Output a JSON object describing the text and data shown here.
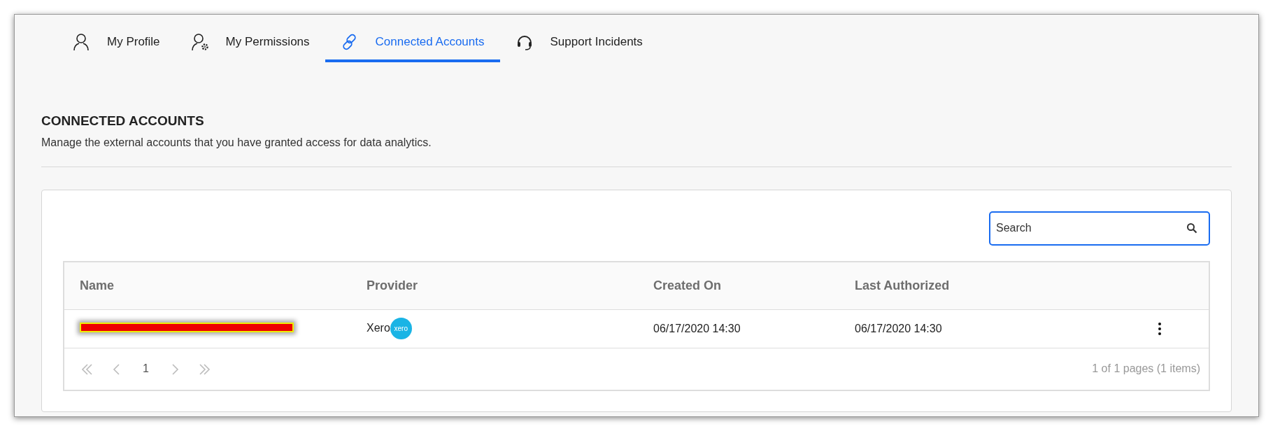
{
  "tabs": [
    {
      "label": "My Profile",
      "selected": false
    },
    {
      "label": "My Permissions",
      "selected": false
    },
    {
      "label": "Connected Accounts",
      "selected": true
    },
    {
      "label": "Support Incidents",
      "selected": false
    }
  ],
  "section": {
    "title": "CONNECTED ACCOUNTS",
    "description": "Manage the external accounts that you have granted access for data analytics."
  },
  "search": {
    "placeholder": "Search"
  },
  "table": {
    "columns": [
      "Name",
      "Provider",
      "Created On",
      "Last Authorized"
    ],
    "rows": [
      {
        "name_redacted": true,
        "provider": "Xero",
        "provider_logo_text": "xero",
        "created_on": "06/17/2020 14:30",
        "last_authorized": "06/17/2020 14:30"
      }
    ]
  },
  "pager": {
    "page": "1",
    "summary": "1 of 1 pages (1 items)"
  }
}
